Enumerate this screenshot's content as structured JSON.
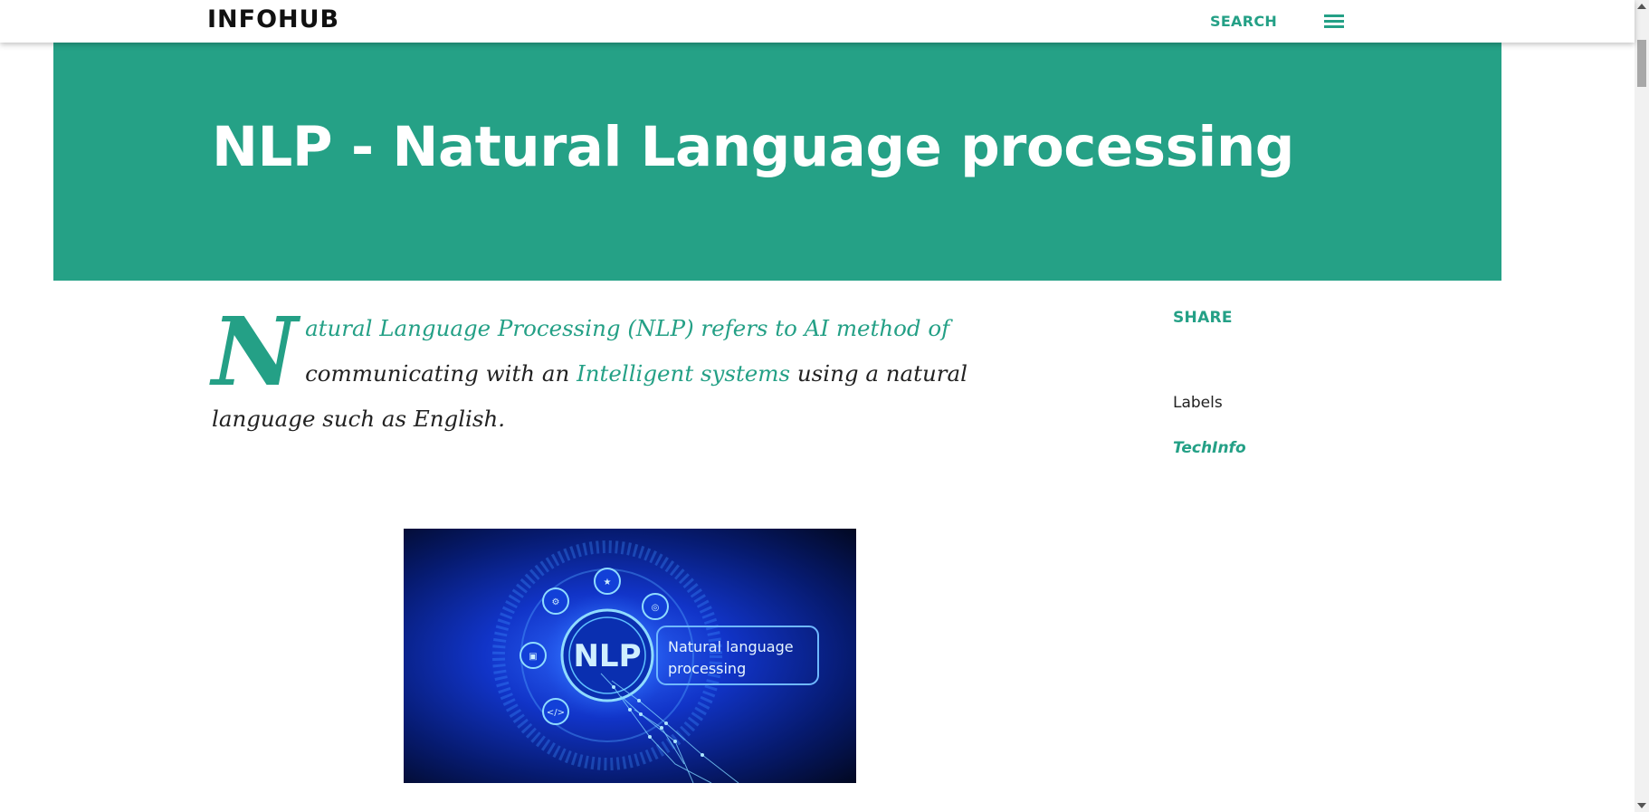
{
  "header": {
    "brand": "INFOHUB",
    "search_label": "SEARCH",
    "menu_icon": "hamburger-menu-icon"
  },
  "post": {
    "title": "NLP - Natural Language processing",
    "dropcap": "N",
    "intro_link": "atural Language Processing (NLP) refers to AI method of",
    "text_1": "communicating with an",
    "inline_link": "Intelligent systems",
    "text_2": "using a natural language such as English.",
    "image": {
      "title": "NLP",
      "caption_line1": "Natural language",
      "caption_line2": "processing"
    }
  },
  "sidebar": {
    "share_label": "SHARE",
    "labels_heading": "Labels",
    "label_items": [
      "TechInfo"
    ]
  },
  "colors": {
    "accent": "#24a086",
    "hero_bg": "#25a186"
  }
}
